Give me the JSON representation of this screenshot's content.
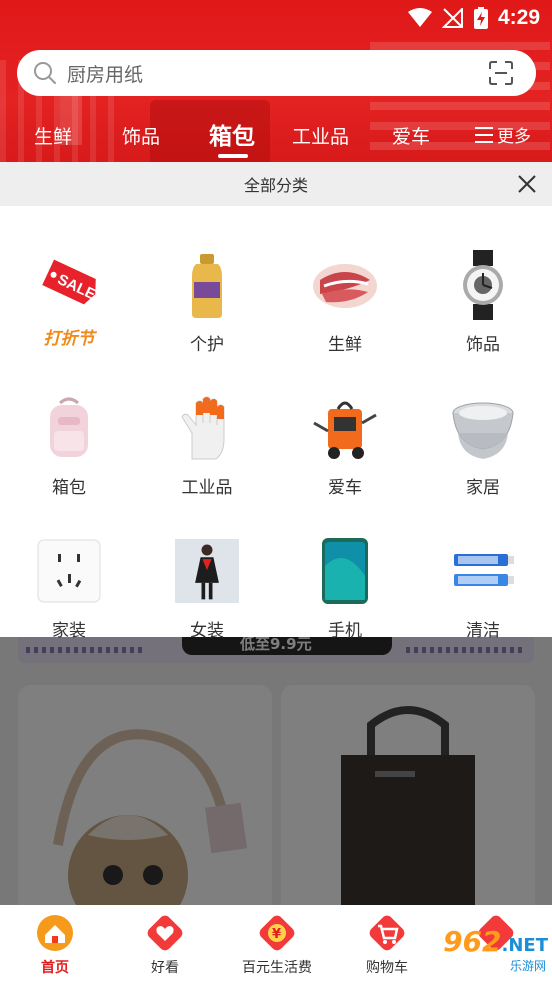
{
  "status": {
    "time": "4:29"
  },
  "search": {
    "placeholder": "厨房用纸"
  },
  "category_tabs": {
    "items": [
      {
        "label": "生鲜"
      },
      {
        "label": "饰品"
      },
      {
        "label": "箱包",
        "active": true
      },
      {
        "label": "工业品"
      },
      {
        "label": "爱车"
      }
    ],
    "more_label": "更多"
  },
  "panel": {
    "title": "全部分类",
    "categories": [
      {
        "label": "打折节",
        "icon": "sale-tag-icon"
      },
      {
        "label": "个护",
        "icon": "shampoo-bottle-icon"
      },
      {
        "label": "生鲜",
        "icon": "meat-icon"
      },
      {
        "label": "饰品",
        "icon": "watch-icon"
      },
      {
        "label": "箱包",
        "icon": "backpack-icon"
      },
      {
        "label": "工业品",
        "icon": "work-glove-icon"
      },
      {
        "label": "爱车",
        "icon": "pressure-washer-icon"
      },
      {
        "label": "家居",
        "icon": "steel-bowl-icon"
      },
      {
        "label": "家装",
        "icon": "wall-socket-icon"
      },
      {
        "label": "女装",
        "icon": "dress-icon"
      },
      {
        "label": "手机",
        "icon": "smartphone-icon"
      },
      {
        "label": "清洁",
        "icon": "toothpaste-icon"
      }
    ]
  },
  "banner": {
    "text": "低至9.9元"
  },
  "bottom_nav": {
    "items": [
      {
        "label": "首页",
        "active": true
      },
      {
        "label": "好看"
      },
      {
        "label": "百元生活费"
      },
      {
        "label": "购物车"
      }
    ]
  },
  "watermark": {
    "number": "962",
    "suffix": ".NET",
    "sub": "乐游网"
  },
  "colors": {
    "brand_red": "#e31d1d",
    "overlay": "rgba(0,0,0,0.5)"
  }
}
